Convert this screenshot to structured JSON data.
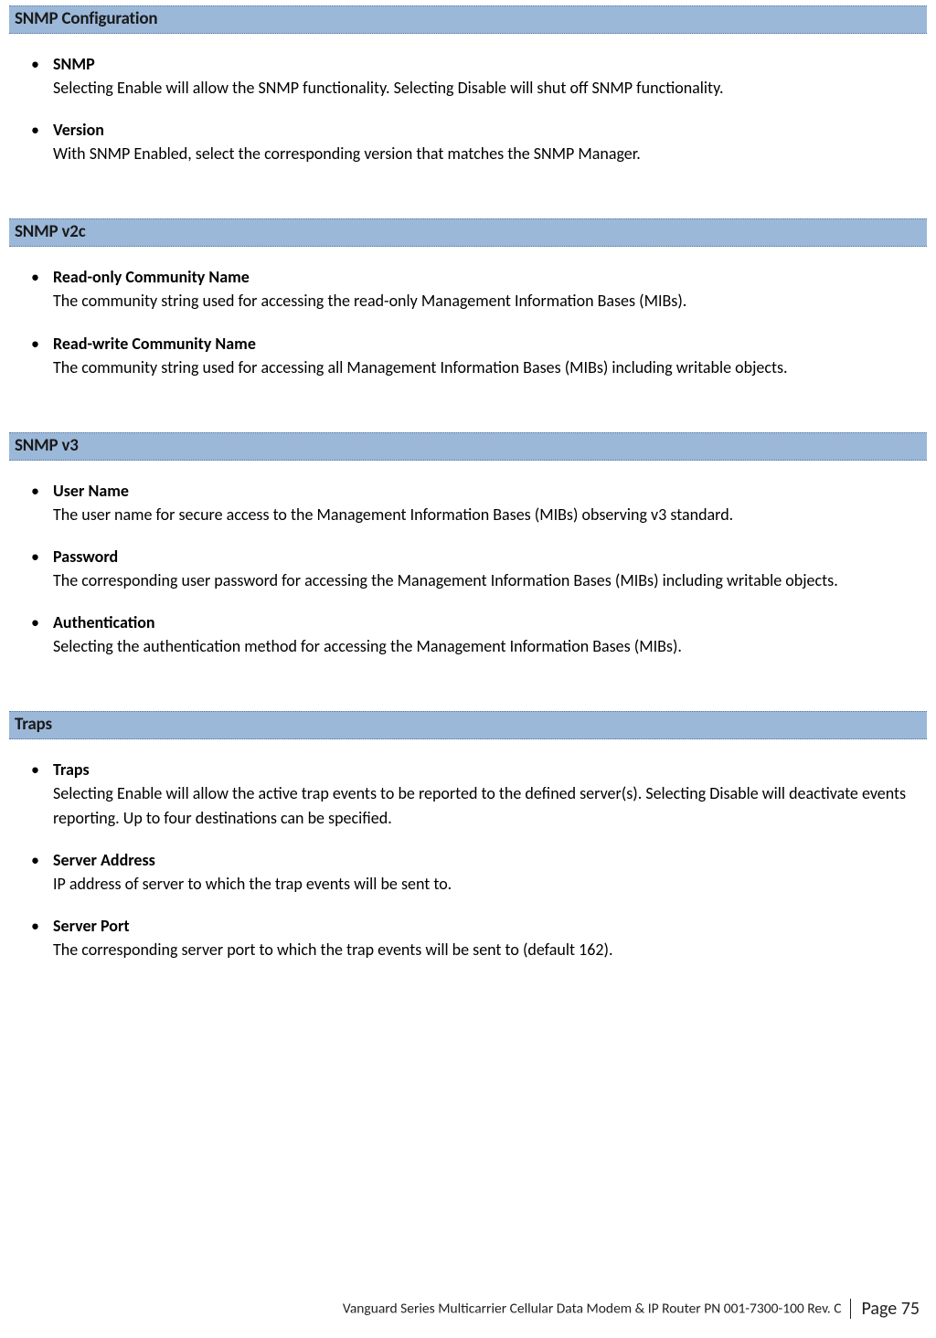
{
  "sections": [
    {
      "title": "SNMP Configuration",
      "items": [
        {
          "title": "SNMP",
          "desc": "Selecting Enable will allow the SNMP functionality. Selecting Disable will shut off SNMP functionality."
        },
        {
          "title": "Version",
          "desc": "With SNMP Enabled, select the corresponding version that matches the SNMP Manager."
        }
      ]
    },
    {
      "title": "SNMP v2c",
      "items": [
        {
          "title": "Read-only Community Name",
          "desc": "The community string used for accessing the read-only Management Information Bases (MIBs)."
        },
        {
          "title": "Read-write Community Name",
          "desc": "The community string used for accessing all Management Information Bases (MIBs) including writable objects."
        }
      ]
    },
    {
      "title": "SNMP v3",
      "items": [
        {
          "title": "User Name",
          "desc": "The user name for secure access to the Management Information Bases (MIBs) observing v3 standard."
        },
        {
          "title": "Password",
          "desc": "The corresponding user password for accessing the Management Information Bases (MIBs) including writable objects."
        },
        {
          "title": "Authentication",
          "desc": "Selecting the authentication method for accessing the Management Information Bases (MIBs)."
        }
      ]
    },
    {
      "title": "Traps",
      "items": [
        {
          "title": "Traps",
          "desc": "Selecting Enable will allow the active trap events to be reported to the defined server(s). Selecting Disable will deactivate events reporting. Up to four destinations can be specified."
        },
        {
          "title": "Server Address",
          "desc": "IP address of server to which the trap events will be sent to."
        },
        {
          "title": "Server Port",
          "desc": "The corresponding server port to which the trap events will be sent to (default 162)."
        }
      ]
    }
  ],
  "footer": {
    "doc_title": "Vanguard Series Multicarrier Cellular Data Modem & IP Router PN 001-7300-100 Rev. C",
    "page_label": "Page 75"
  }
}
